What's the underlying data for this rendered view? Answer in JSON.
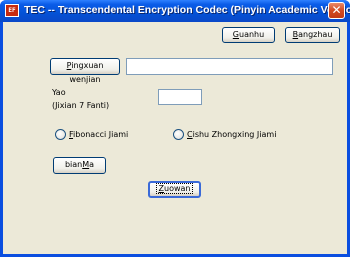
{
  "window": {
    "title": "TEC -- Transcendental Encryption Codec (Pinyin Academic Version)",
    "app_icon_text": "EF",
    "close_symbol": "✕"
  },
  "buttons": {
    "guanhu": {
      "pre": "",
      "mnemonic": "G",
      "post": "uanhu"
    },
    "bangzhau": {
      "pre": "",
      "mnemonic": "B",
      "post": "angzhau"
    },
    "pingxuan": {
      "pre": "",
      "mnemonic": "P",
      "post": "ingxuan wenjian"
    },
    "bianma": {
      "pre": "bian",
      "mnemonic": "M",
      "post": "a"
    },
    "zuowan": {
      "pre": "",
      "mnemonic": "Z",
      "post": "uowan"
    }
  },
  "file_field": {
    "value": ""
  },
  "yao": {
    "label": "Yao",
    "hint": "(Jixian 7 Fanti)",
    "value": ""
  },
  "radios": {
    "fibonacci": {
      "pre": "",
      "mnemonic": "F",
      "post": "ibonacci Jiami",
      "selected": false
    },
    "cishu": {
      "pre": "",
      "mnemonic": "C",
      "post": "ishu Zhongxing Jiami",
      "selected": false
    }
  }
}
